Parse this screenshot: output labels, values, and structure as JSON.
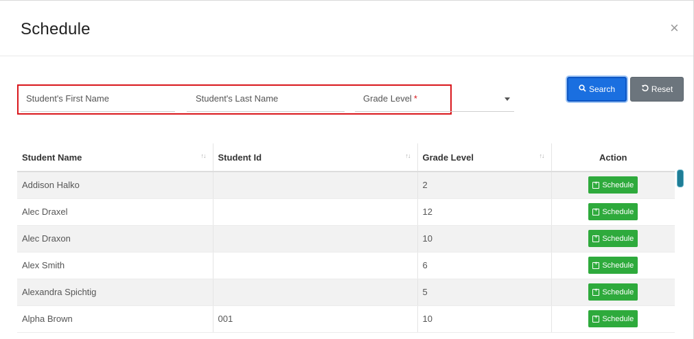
{
  "dialog": {
    "title": "Schedule",
    "close_label": "×"
  },
  "filters": {
    "first_name_placeholder": "Student's First Name",
    "last_name_placeholder": "Student's Last Name",
    "grade_level_label": "Grade Level",
    "grade_level_required": "*",
    "search_label": "Search",
    "reset_label": "Reset"
  },
  "table": {
    "columns": [
      {
        "label": "Student Name",
        "sortable": true
      },
      {
        "label": "Student Id",
        "sortable": true
      },
      {
        "label": "Grade Level",
        "sortable": true
      },
      {
        "label": "Action",
        "sortable": false
      }
    ],
    "action_label": "Schedule",
    "rows": [
      {
        "name": "Addison Halko",
        "id": "",
        "grade": "2"
      },
      {
        "name": "Alec Draxel",
        "id": "",
        "grade": "12"
      },
      {
        "name": "Alec Draxon",
        "id": "",
        "grade": "10"
      },
      {
        "name": "Alex Smith",
        "id": "",
        "grade": "6"
      },
      {
        "name": "Alexandra Spichtig",
        "id": "",
        "grade": "5"
      },
      {
        "name": "Alpha Brown",
        "id": "001",
        "grade": "10"
      }
    ]
  },
  "colors": {
    "primary": "#1a6fe0",
    "secondary": "#6c757d",
    "success": "#2eaa3c",
    "highlight_border": "#d9161b"
  }
}
